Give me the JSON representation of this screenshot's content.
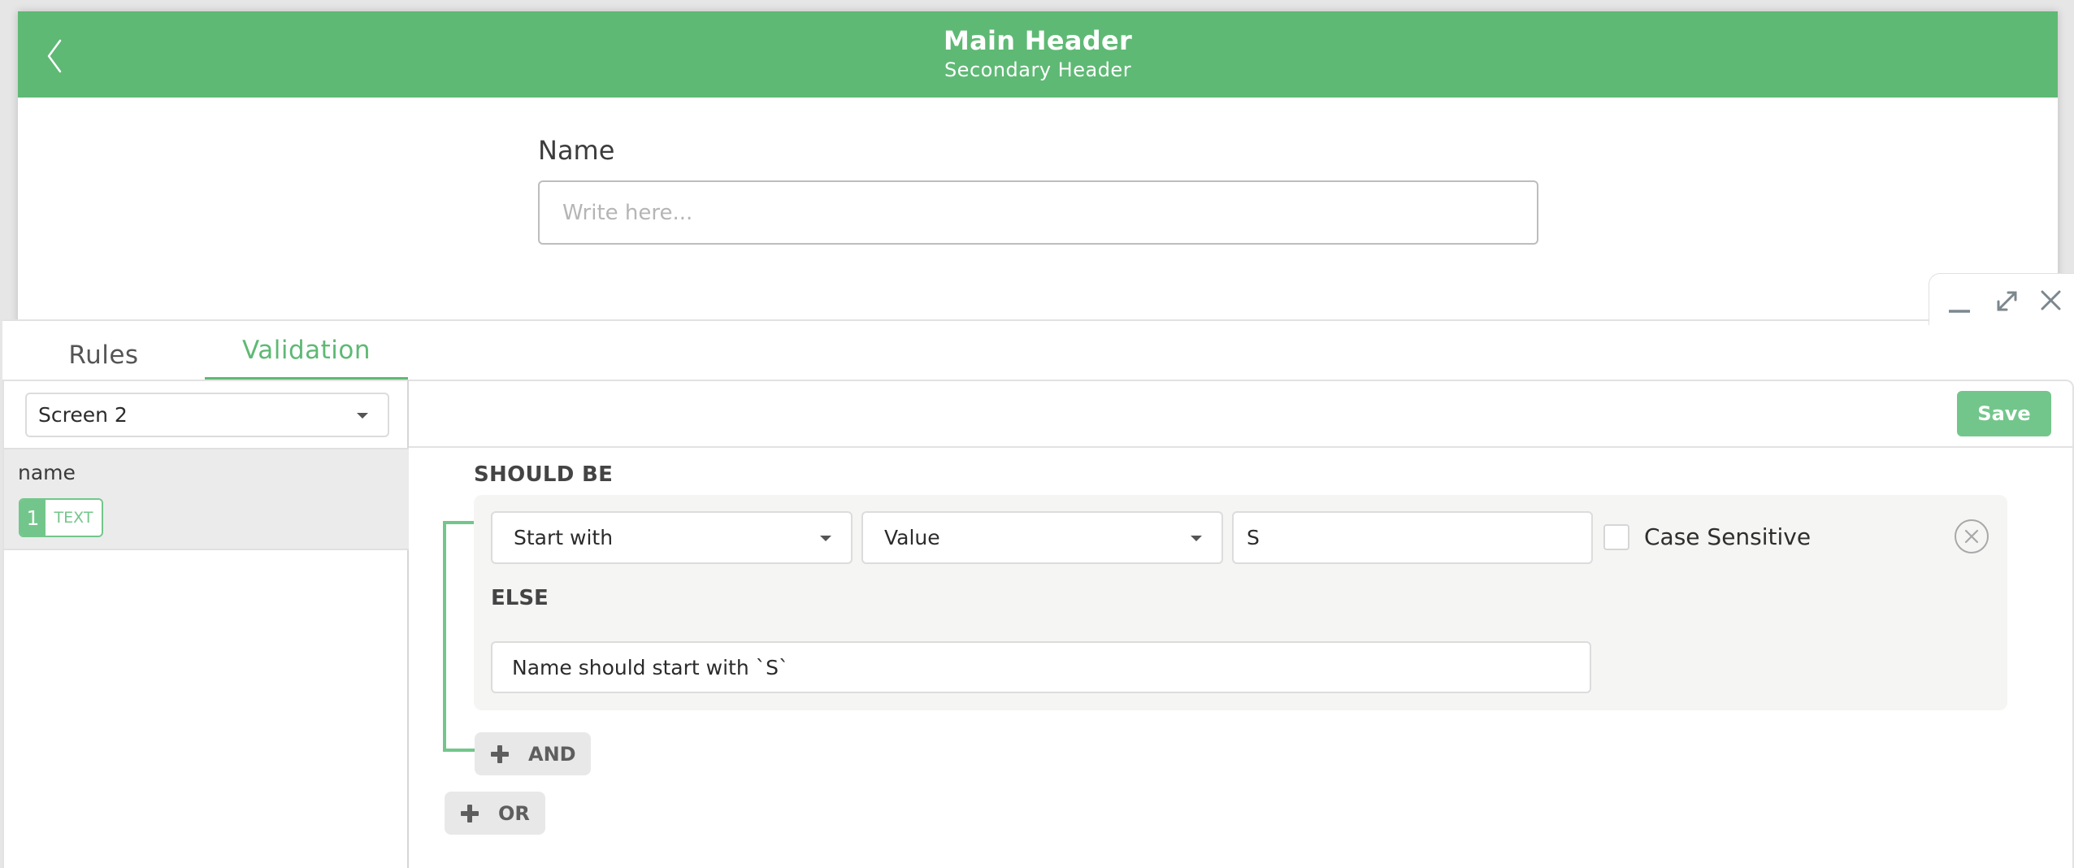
{
  "preview": {
    "header": {
      "main_title": "Main Header",
      "sub_title": "Secondary Header",
      "back_icon": "chevron-left-icon",
      "color": "#5eb974"
    },
    "form": {
      "label": "Name",
      "placeholder": "Write here...",
      "value": ""
    }
  },
  "window_controls": {
    "minimize_icon": "minimize-icon",
    "maximize_icon": "expand-icon",
    "close_icon": "close-icon"
  },
  "tabs": [
    {
      "label": "Rules",
      "active": false
    },
    {
      "label": "Validation",
      "active": true
    }
  ],
  "sidebar": {
    "screen_select": {
      "value": "Screen 2"
    },
    "fields": [
      {
        "name": "name",
        "index": "1",
        "type": "TEXT",
        "selected": true
      }
    ]
  },
  "toolbar": {
    "save_label": "Save"
  },
  "rule": {
    "should_be_label": "SHOULD BE",
    "operator": "Start with",
    "value_type": "Value",
    "value": "S",
    "case_sensitive_label": "Case Sensitive",
    "case_sensitive": false,
    "else_label": "ELSE",
    "else_message": "Name should start with `S`",
    "remove_icon": "remove-circle-icon"
  },
  "buttons": {
    "and_label": "AND",
    "or_label": "OR"
  },
  "colors": {
    "accent": "#5eb974",
    "accent_light": "#73c68b",
    "condition_bg": "#f5f5f4",
    "button_bg": "#e8e8e8"
  }
}
